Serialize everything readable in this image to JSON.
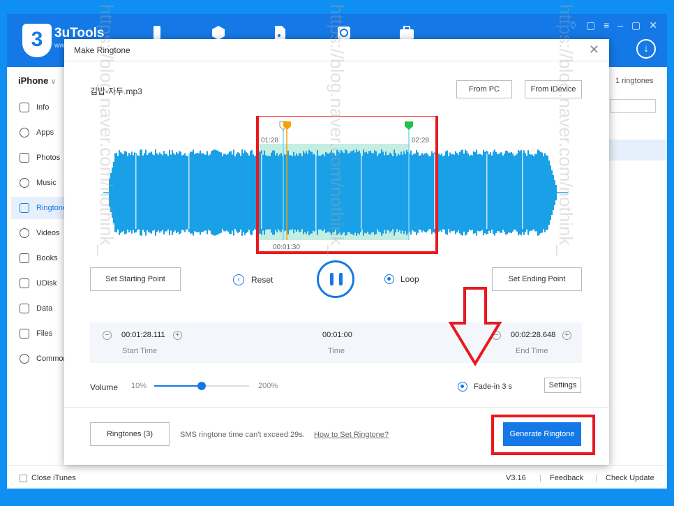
{
  "app": {
    "logo_digit": "3",
    "logo_name": "3uTools",
    "logo_sub": "ww",
    "window_controls": [
      "♢",
      "▢",
      "≡",
      "–",
      "▢",
      "✕"
    ],
    "download_icon": "arrow-down-circle-icon"
  },
  "sidebar": {
    "device": "iPhone",
    "device_chevron": "∨",
    "items": [
      {
        "label": "Info",
        "icon": "phone-icon"
      },
      {
        "label": "Apps",
        "icon": "apps-icon"
      },
      {
        "label": "Photos",
        "icon": "photo-icon"
      },
      {
        "label": "Music",
        "icon": "music-icon"
      },
      {
        "label": "Ringtones",
        "icon": "bell-icon"
      },
      {
        "label": "Videos",
        "icon": "video-icon"
      },
      {
        "label": "Books",
        "icon": "book-icon"
      },
      {
        "label": "UDisk",
        "icon": "udisk-icon"
      },
      {
        "label": "Data",
        "icon": "data-icon"
      },
      {
        "label": "Files",
        "icon": "folder-icon"
      },
      {
        "label": "Common",
        "icon": "grid-icon"
      }
    ]
  },
  "right_pane": {
    "count": "1 ringtones"
  },
  "status": {
    "close_itunes": "Close iTunes",
    "version": "V3.16",
    "feedback": "Feedback",
    "check_update": "Check Update"
  },
  "dialog": {
    "title": "Make Ringtone",
    "close": "✕",
    "file_name": "김밥-자두.mp3",
    "from_pc": "From PC",
    "from_idevice": "From iDevice",
    "marker_start": "01:28",
    "marker_end": "02:28",
    "playhead": "00:01:30",
    "set_start": "Set Starting Point",
    "set_end": "Set Ending Point",
    "reset": "Reset",
    "loop": "Loop",
    "start_time": "00:01:28.111",
    "start_label": "Start Time",
    "duration": "00:01:00",
    "duration_label": "Time",
    "end_time": "00:02:28.648",
    "end_label": "End Time",
    "volume_label": "Volume",
    "volume_min": "10%",
    "volume_max": "200%",
    "volume_level": 0.5,
    "fade_in": "Fade-in 3 s",
    "settings": "Settings",
    "ringtones_btn": "Ringtones (3)",
    "sms_note": "SMS ringtone time can't exceed 29s.",
    "how_to": "How to Set Ringtone?",
    "generate": "Generate Ringtone"
  },
  "colors": {
    "accent": "#1479e6",
    "wave": "#1aa0e6",
    "selection": "#3cc8a0",
    "annotation": "#e8191f",
    "start_marker": "#f5a300",
    "end_marker": "#1ec24a"
  },
  "watermark": "https://blog.naver.com/nothink_"
}
